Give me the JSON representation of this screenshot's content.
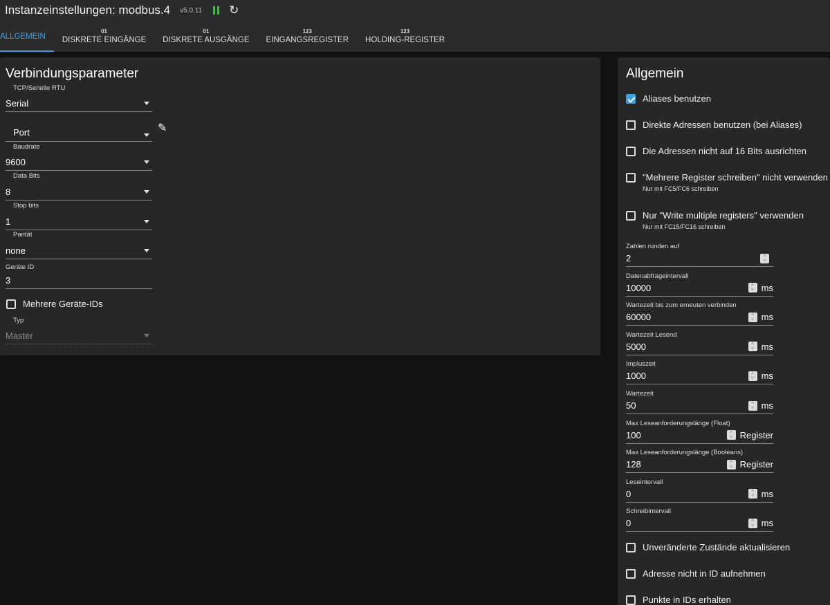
{
  "header": {
    "title": "Instanzeinstellungen: modbus.4",
    "version": "v5.0.11"
  },
  "tabs": [
    {
      "label": "ALLGEMEIN"
    },
    {
      "icon": "01",
      "label": "DISKRETE EINGÄNGE"
    },
    {
      "icon": "01",
      "label": "DISKRETE AUSGÄNGE"
    },
    {
      "icon": "123",
      "label": "EINGANGSREGISTER"
    },
    {
      "icon": "123",
      "label": "HOLDING-REGISTER"
    }
  ],
  "connection": {
    "title": "Verbindungsparameter",
    "type_label": "TCP/Serielle RTU",
    "type_value": "Serial",
    "port_value": "Port",
    "baud_label": "Baudrate",
    "baud_value": "9600",
    "databits_label": "Data Bits",
    "databits_value": "8",
    "stopbits_label": "Stop bits",
    "stopbits_value": "1",
    "parity_label": "Parität",
    "parity_value": "none",
    "deviceid_label": "Geräte ID",
    "deviceid_value": "3",
    "multi_ids_label": "Mehrere Geräte-IDs",
    "mode_label": "Typ",
    "mode_value": "Master"
  },
  "general": {
    "title": "Allgemein",
    "checks": [
      {
        "label": "Aliases benutzen",
        "checked": true
      },
      {
        "label": "Direkte Adressen benutzen (bei Aliases)",
        "checked": false
      },
      {
        "label": "Die Adressen nicht auf 16 Bits ausrichten",
        "checked": false
      },
      {
        "label": "\"Mehrere Register schreiben\" nicht verwenden",
        "hint": "Nur mit FC5/FC6 schreiben",
        "checked": false
      },
      {
        "label": "Nur \"Write multiple registers\" verwenden",
        "hint": "Nur mit FC15/FC16 schreiben",
        "checked": false
      },
      {
        "label": "Unveränderte Zustände aktualisieren",
        "checked": false
      },
      {
        "label": "Adresse nicht in ID aufnehmen",
        "checked": false
      },
      {
        "label": "Punkte in IDs erhalten",
        "checked": false
      }
    ],
    "fields": [
      {
        "label": "Zahlen runden auf",
        "value": "2",
        "unit": ""
      },
      {
        "label": "Datenabfrageintervall",
        "value": "10000",
        "unit": "ms"
      },
      {
        "label": "Wartezeit bis zum erneuten verbinden",
        "value": "60000",
        "unit": "ms"
      },
      {
        "label": "Wartezeit Lesend",
        "value": "5000",
        "unit": "ms"
      },
      {
        "label": "Impluszeit",
        "value": "1000",
        "unit": "ms"
      },
      {
        "label": "Wartezeit",
        "value": "50",
        "unit": "ms"
      },
      {
        "label": "Max Leseanforderungslänge (Float)",
        "value": "100",
        "unit": "Register"
      },
      {
        "label": "Max Leseanforderungslänge (Booleans)",
        "value": "128",
        "unit": "Register"
      },
      {
        "label": "Leseintervall",
        "value": "0",
        "unit": "ms"
      },
      {
        "label": "Schreibintervall",
        "value": "0",
        "unit": "ms"
      }
    ]
  },
  "colors": {
    "accent": "#3f9fe0",
    "running": "#4caf50"
  }
}
